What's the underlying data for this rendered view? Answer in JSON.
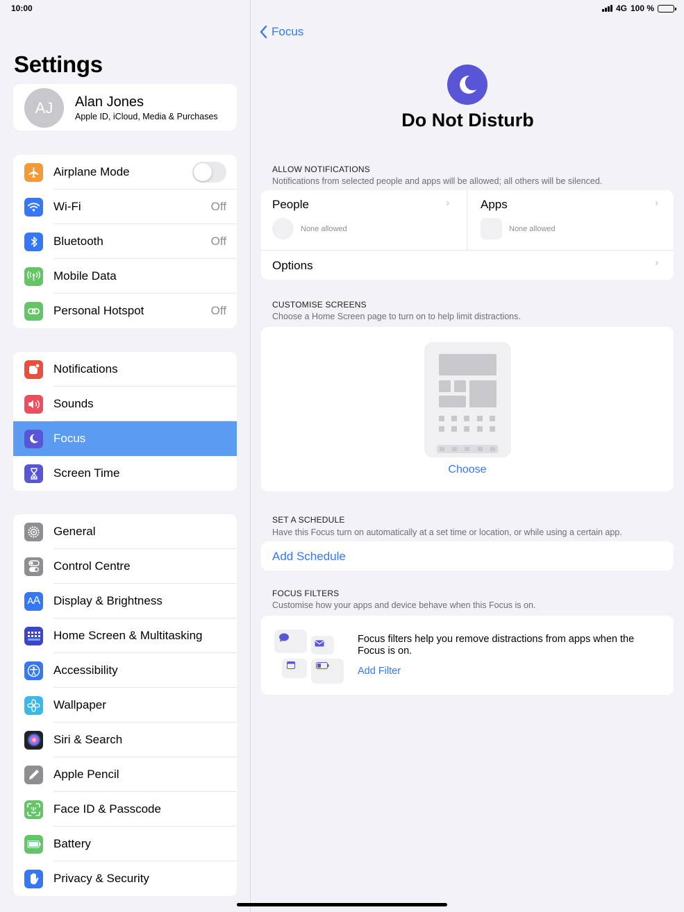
{
  "status_bar": {
    "time": "10:00",
    "network": "4G",
    "battery": "100 %"
  },
  "sidebar": {
    "title": "Settings",
    "profile": {
      "initials": "AJ",
      "name": "Alan Jones",
      "subtitle": "Apple ID, iCloud, Media & Purchases"
    },
    "groups": [
      [
        {
          "label": "Airplane Mode",
          "icon": "airplane-icon",
          "color": "#f19a37",
          "toggle": "off"
        },
        {
          "label": "Wi-Fi",
          "icon": "wifi-icon",
          "color": "#3478f6",
          "value": "Off"
        },
        {
          "label": "Bluetooth",
          "icon": "bluetooth-icon",
          "color": "#3478f6",
          "value": "Off"
        },
        {
          "label": "Mobile Data",
          "icon": "antenna-icon",
          "color": "#65c466"
        },
        {
          "label": "Personal Hotspot",
          "icon": "hotspot-icon",
          "color": "#65c466",
          "value": "Off"
        }
      ],
      [
        {
          "label": "Notifications",
          "icon": "notifications-icon",
          "color": "#eb4e3d"
        },
        {
          "label": "Sounds",
          "icon": "speaker-icon",
          "color": "#eb4e5d"
        },
        {
          "label": "Focus",
          "icon": "moon-icon",
          "color": "#5856d6",
          "active": true
        },
        {
          "label": "Screen Time",
          "icon": "hourglass-icon",
          "color": "#5856d6"
        }
      ],
      [
        {
          "label": "General",
          "icon": "gear-icon",
          "color": "#8e8e93"
        },
        {
          "label": "Control Centre",
          "icon": "switches-icon",
          "color": "#8e8e93"
        },
        {
          "label": "Display & Brightness",
          "icon": "text-size-icon",
          "color": "#3478f6"
        },
        {
          "label": "Home Screen & Multitasking",
          "icon": "app-grid-icon",
          "color": "#3d44c9"
        },
        {
          "label": "Accessibility",
          "icon": "accessibility-icon",
          "color": "#3478f6"
        },
        {
          "label": "Wallpaper",
          "icon": "flower-icon",
          "color": "#3ab8e8"
        },
        {
          "label": "Siri & Search",
          "icon": "siri-icon",
          "color": "#222226"
        },
        {
          "label": "Apple Pencil",
          "icon": "pencil-icon",
          "color": "#8e8e93"
        },
        {
          "label": "Face ID & Passcode",
          "icon": "face-id-icon",
          "color": "#65c466"
        },
        {
          "label": "Battery",
          "icon": "battery-icon",
          "color": "#65c466"
        },
        {
          "label": "Privacy & Security",
          "icon": "hand-icon",
          "color": "#3478f6"
        }
      ]
    ]
  },
  "detail": {
    "back_label": "Focus",
    "title": "Do Not Disturb",
    "allow": {
      "heading": "ALLOW NOTIFICATIONS",
      "subtitle": "Notifications from selected people and apps will be allowed; all others will be silenced.",
      "people_label": "People",
      "people_value": "None allowed",
      "apps_label": "Apps",
      "apps_value": "None allowed",
      "options_label": "Options"
    },
    "customise": {
      "heading": "CUSTOMISE SCREENS",
      "subtitle": "Choose a Home Screen page to turn on to help limit distractions.",
      "choose_label": "Choose"
    },
    "schedule": {
      "heading": "SET A SCHEDULE",
      "subtitle": "Have this Focus turn on automatically at a set time or location, or while using a certain app.",
      "add_label": "Add Schedule"
    },
    "filters": {
      "heading": "FOCUS FILTERS",
      "subtitle": "Customise how your apps and device behave when this Focus is on.",
      "description": "Focus filters help you remove distractions from apps when the Focus is on.",
      "add_label": "Add Filter"
    }
  },
  "colors": {
    "accent": "#3478f6",
    "focus": "#5856d6",
    "selected_row": "#5b9cf2"
  }
}
